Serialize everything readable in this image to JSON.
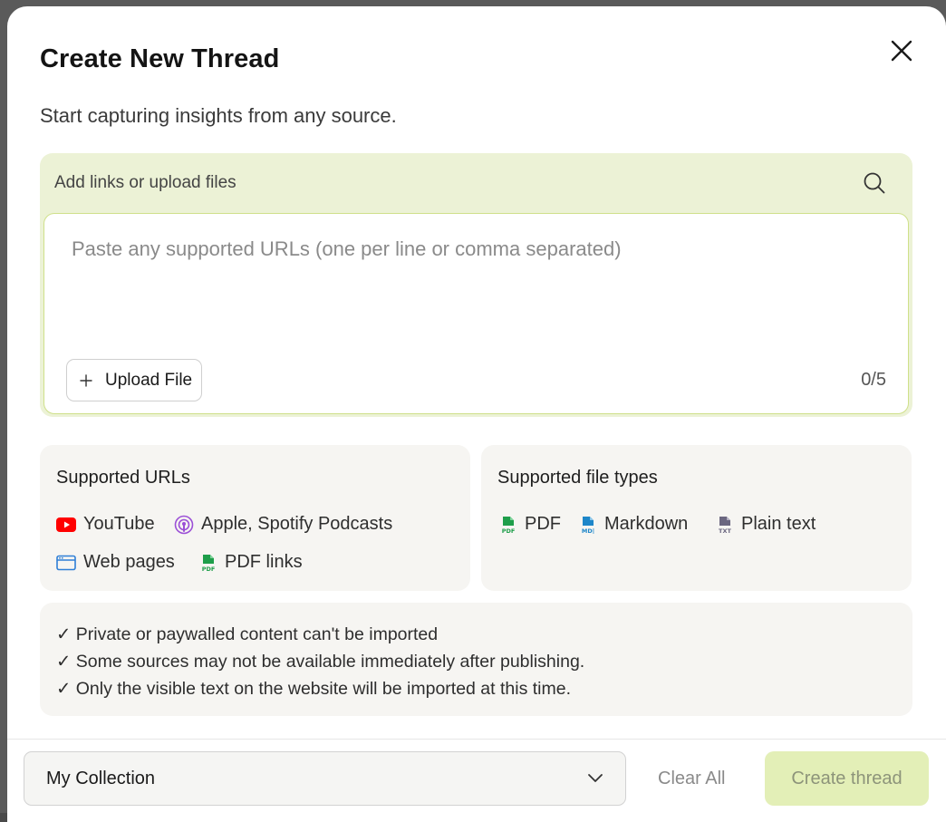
{
  "modal": {
    "title": "Create New Thread",
    "subtitle": "Start capturing insights from any source."
  },
  "input": {
    "label": "Add links or upload files",
    "placeholder": "Paste any supported URLs (one per line or comma separated)",
    "upload_label": "Upload File",
    "counter": "0/5"
  },
  "supported_urls": {
    "title": "Supported URLs",
    "items": [
      {
        "label": "YouTube",
        "icon": "youtube-icon"
      },
      {
        "label": "Apple, Spotify Podcasts",
        "icon": "podcast-icon"
      },
      {
        "label": "Web pages",
        "icon": "browser-window-icon"
      },
      {
        "label": "PDF links",
        "icon": "pdf-file-icon"
      }
    ]
  },
  "supported_types": {
    "title": "Supported file types",
    "items": [
      {
        "label": "PDF",
        "icon": "pdf-file-icon"
      },
      {
        "label": "Markdown",
        "icon": "markdown-file-icon"
      },
      {
        "label": "Plain text",
        "icon": "txt-file-icon"
      }
    ]
  },
  "notes": [
    "✓ Private or paywalled content can't be imported",
    "✓ Some sources may not be available immediately after publishing.",
    "✓ Only the visible text on the website will be imported at this time."
  ],
  "footer": {
    "collection": "My Collection",
    "clear_label": "Clear All",
    "create_label": "Create thread"
  },
  "colors": {
    "input_panel": "#ecf2d6",
    "create_button": "#e3efb7",
    "youtube": "#ff0000",
    "podcast": "#9b4fd6",
    "pdf": "#1e9e4a",
    "markdown": "#1d86c9",
    "txt": "#6b6780",
    "web": "#2f7fd6"
  }
}
